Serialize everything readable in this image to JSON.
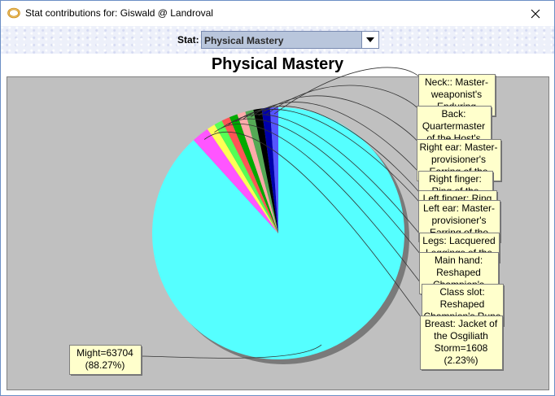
{
  "window": {
    "title": "Stat contributions for: Giswald @ Landroval"
  },
  "toolbar": {
    "stat_label": "Stat:",
    "stat_value": "Physical Mastery"
  },
  "icons": {
    "app": "lotro-ring-icon",
    "close": "close-icon",
    "dropdown": "chevron-down-icon"
  },
  "chart_data": {
    "type": "pie",
    "title": "Physical Mastery",
    "slices": [
      {
        "label": "Might",
        "value": 63704,
        "percent": 88.27,
        "color": "#55ffff",
        "callout": "Might=63704\n(88.27%)"
      },
      {
        "label": "Breast",
        "value": 1608,
        "percent": 2.23,
        "color": "#ff55ff",
        "callout": "Breast: Jacket of\nthe Osgiliath\nStorm=1608\n(2.23%)"
      },
      {
        "label": "Class slot",
        "value": null,
        "color": "#ffff55",
        "callout": "Class slot:\nReshaped\nChampion's Rune"
      },
      {
        "label": "Main hand",
        "value": null,
        "color": "#55ff55",
        "callout": "Main hand:\nReshaped\nChampion's"
      },
      {
        "label": "Legs",
        "value": null,
        "color": "#ff5555",
        "callout": "Legs: Lacquered\nLeggings of the"
      },
      {
        "label": "Left ear",
        "value": null,
        "color": "#00aa00",
        "callout": "Left ear: Master-\nprovisioner's\nEarring of the"
      },
      {
        "label": "Left finger",
        "value": null,
        "color": "#ffaaaa",
        "callout": "Left finger: Ring"
      },
      {
        "label": "Right finger",
        "value": null,
        "color": "#55aa55",
        "callout": "Right finger:\nRing of the"
      },
      {
        "label": "Right ear",
        "value": null,
        "color": "#000000",
        "callout": "Right ear: Master-\nprovisioner's\nEarring of the"
      },
      {
        "label": "Back",
        "value": null,
        "color": "#0000aa",
        "callout": "Back:\nQuartermaster\nof the Host's"
      },
      {
        "label": "Neck",
        "value": null,
        "color": "#5555ff",
        "callout": "Neck:: Master-\nweaponist's\nEnduring"
      }
    ],
    "colors": {
      "plot_background": "#c0c0c0",
      "callout_fill": "#ffffcc"
    }
  }
}
